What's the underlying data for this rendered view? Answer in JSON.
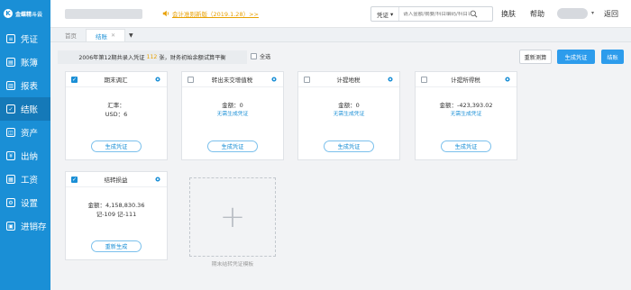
{
  "sidebar": {
    "logo_text": "金蝶精斗云",
    "logo_mark": "K",
    "items": [
      {
        "label": "凭证",
        "icon": "voucher-icon",
        "glyph": "≡"
      },
      {
        "label": "账簿",
        "icon": "ledger-icon",
        "glyph": "▤"
      },
      {
        "label": "报表",
        "icon": "report-icon",
        "glyph": "▥"
      },
      {
        "label": "结账",
        "icon": "checkout-icon",
        "glyph": "✓"
      },
      {
        "label": "资产",
        "icon": "asset-icon",
        "glyph": "◫"
      },
      {
        "label": "出纳",
        "icon": "cashier-icon",
        "glyph": "¥"
      },
      {
        "label": "工资",
        "icon": "salary-icon",
        "glyph": "▦"
      },
      {
        "label": "设置",
        "icon": "settings-icon",
        "glyph": "⚙"
      },
      {
        "label": "进销存",
        "icon": "inventory-icon",
        "glyph": "▣"
      }
    ]
  },
  "header": {
    "notice": "会计准则新版（2019.1.28）>>",
    "search_type": "凭证",
    "search_placeholder": "请入金额/摘要/科目编码/科目名称",
    "links": [
      "换肤",
      "帮助",
      "返回"
    ]
  },
  "tabs": {
    "home": "首页",
    "active": "结账"
  },
  "toolbar": {
    "summary_prefix": "2006年第12期共录入凭证",
    "summary_count": "112",
    "summary_suffix": "张，财务初始余额试算平衡",
    "check_all": "全选",
    "recalc": "重新测算",
    "generate": "生成凭证",
    "checkout": "结账"
  },
  "cards": [
    {
      "title": "期末调汇",
      "checked": true,
      "line1": "汇率：",
      "line2": "USD：6",
      "sub": "",
      "button": "生成凭证"
    },
    {
      "title": "转出未交增值税",
      "checked": false,
      "line1": "金额：0",
      "line2": "",
      "sub": "无需生成凭证",
      "button": "生成凭证"
    },
    {
      "title": "计提地税",
      "checked": false,
      "line1": "金额：0",
      "line2": "",
      "sub": "无需生成凭证",
      "button": "生成凭证"
    },
    {
      "title": "计提所得税",
      "checked": false,
      "line1": "金额：-423,393.02",
      "line2": "",
      "sub": "无需生成凭证",
      "button": "生成凭证"
    },
    {
      "title": "结转损益",
      "checked": true,
      "line1": "金额：4,158,830.36",
      "line2": "记-109 记-111",
      "sub": "",
      "button": "重新生成"
    }
  ],
  "add_card_label": "期末结转凭证模板",
  "colors": {
    "brand": "#1a8fd6",
    "accent": "#e8a000"
  }
}
